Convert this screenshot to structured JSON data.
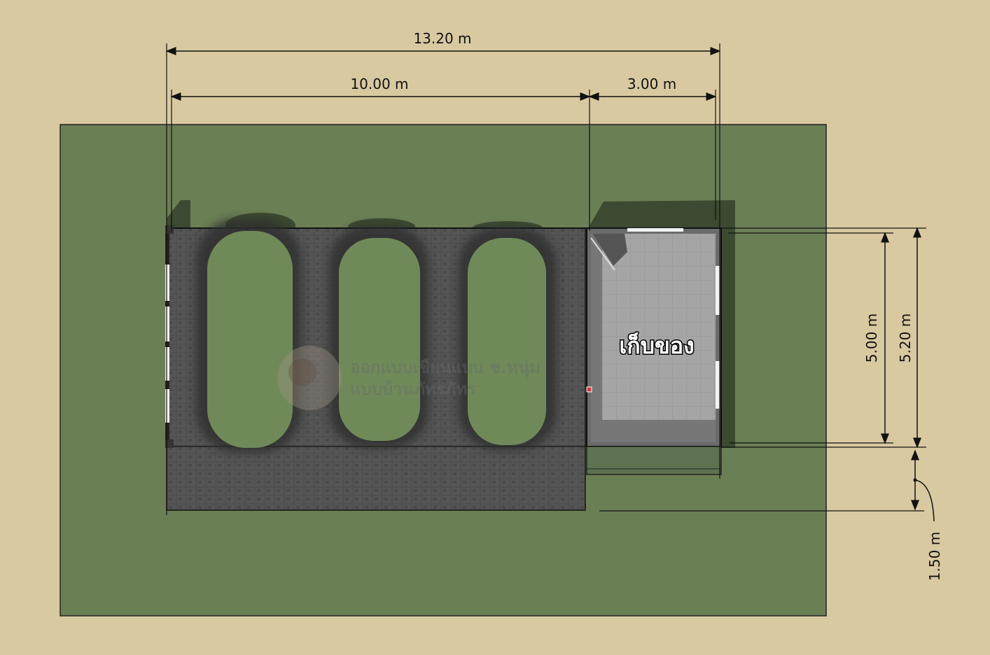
{
  "dimensions": {
    "total_width": "13.20 m",
    "carport_width": "10.00 m",
    "storage_width": "3.00 m",
    "storage_depth_inner": "5.00 m",
    "storage_depth_outer": "5.20 m",
    "front_extension": "1.50 m"
  },
  "rooms": {
    "storage_label": "เก็บของ"
  },
  "watermark": {
    "line1": "ออกแบบเขียนแบบ ช.หนุ่ม",
    "line2": "แบบบ้านภัทรภัทร"
  },
  "colors": {
    "background": "#d8c9a1",
    "lawn": "#6b7f55",
    "paving": "#4f4f4f",
    "car": "#6f8a58",
    "storage_floor": "#9c9c9c",
    "dimension_line": "#111111"
  }
}
